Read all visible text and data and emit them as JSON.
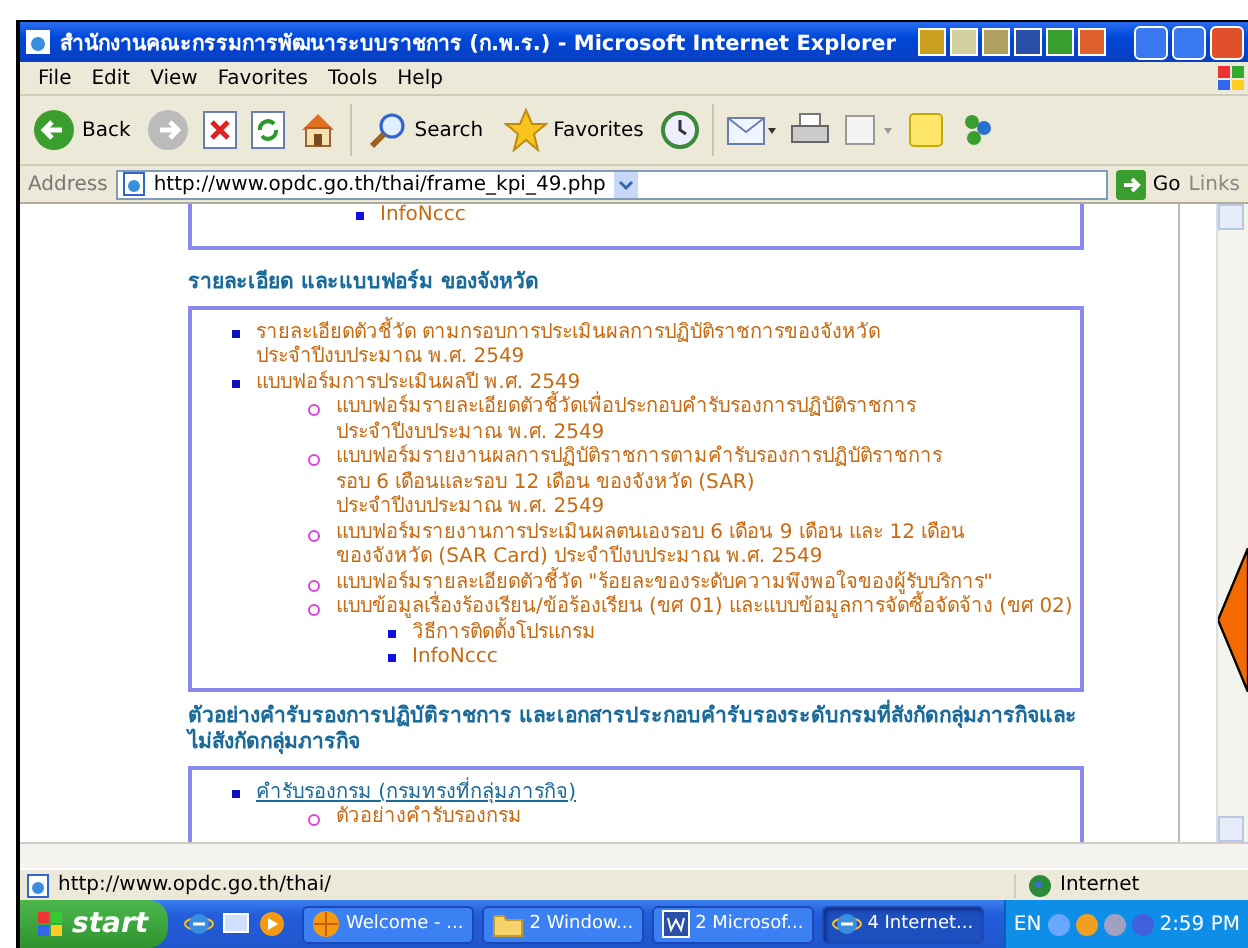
{
  "window": {
    "title": "สำนักงานคณะกรรมการพัฒนาระบบราชการ (ก.พ.ร.) - Microsoft Internet Explorer"
  },
  "menu": [
    "File",
    "Edit",
    "View",
    "Favorites",
    "Tools",
    "Help"
  ],
  "toolbar": [
    {
      "kind": "back",
      "label": "Back"
    },
    {
      "kind": "forward"
    },
    {
      "kind": "stop"
    },
    {
      "kind": "refresh"
    },
    {
      "kind": "home"
    },
    {
      "kind": "search",
      "label": "Search"
    },
    {
      "kind": "favorites",
      "label": "Favorites"
    },
    {
      "kind": "history"
    },
    {
      "kind": "mail"
    },
    {
      "kind": "print"
    },
    {
      "kind": "edit"
    },
    {
      "kind": "notes"
    },
    {
      "kind": "messenger"
    }
  ],
  "address": {
    "label": "Address",
    "value": "http://www.opdc.go.th/thai/frame_kpi_49.php",
    "go": "Go",
    "links": "Links"
  },
  "page": {
    "sections": [
      {
        "items": [
          {
            "kind": "square",
            "text": "InfoNccc"
          }
        ]
      },
      {
        "heading": "รายละเอียด และแบบฟอร์ม ของจังหวัด",
        "items": [
          {
            "kind": "disc",
            "text": "รายละเอียดตัวชี้วัด ตามกรอบการประเมินผลการปฏิบัติราชการของจังหวัด\nประจำปีงบประมาณ พ.ศ. 2549"
          },
          {
            "kind": "disc",
            "text": "แบบฟอร์มการประเมินผลปี พ.ศ. 2549",
            "children": [
              {
                "kind": "circle",
                "text": "แบบฟอร์มรายละเอียดตัวชี้วัดเพื่อประกอบคำรับรองการปฏิบัติราชการ\nประจำปีงบประมาณ พ.ศ. 2549"
              },
              {
                "kind": "circle",
                "text": "แบบฟอร์มรายงานผลการปฏิบัติราชการตามคำรับรองการปฏิบัติราชการ\nรอบ 6 เดือนและรอบ 12 เดือน ของจังหวัด (SAR)\nประจำปีงบประมาณ พ.ศ. 2549"
              },
              {
                "kind": "circle",
                "text": "แบบฟอร์มรายงานการประเมินผลตนเองรอบ 6 เดือน 9 เดือน และ 12 เดือน\nของจังหวัด (SAR Card) ประจำปีงบประมาณ พ.ศ. 2549"
              },
              {
                "kind": "circle",
                "text": "แบบฟอร์มรายละเอียดตัวชี้วัด \"ร้อยละของระดับความพึงพอใจของผู้รับบริการ\""
              },
              {
                "kind": "circle",
                "text": "แบบข้อมูลเรื่องร้องเรียน/ข้อร้องเรียน (ขศ 01) และแบบข้อมูลการจัดซื้อจัดจ้าง (ขศ 02)",
                "children": [
                  {
                    "kind": "square",
                    "text": "วิธีการติดตั้งโปรแกรม"
                  },
                  {
                    "kind": "square",
                    "text": "InfoNccc"
                  }
                ]
              }
            ]
          }
        ]
      },
      {
        "heading": "ตัวอย่างคำรับรองการปฏิบัติราชการ และเอกสารประกอบคำรับรองระดับกรมที่สังกัดกลุ่มภารกิจและ\nไม่สังกัดกลุ่มภารกิจ",
        "items": [
          {
            "kind": "link",
            "text": "คำรับรองกรม (กรมทรงที่กลุ่มภารกิจ)",
            "children": [
              {
                "kind": "circle",
                "text": "ตัวอย่างคำรับรองกรม"
              }
            ]
          }
        ]
      }
    ]
  },
  "status": {
    "url": "http://www.opdc.go.th/thai/",
    "zone": "Internet"
  },
  "taskbar": {
    "start": "start",
    "tasks": [
      {
        "kind": "browser",
        "label": "Welcome - ...",
        "selected": false
      },
      {
        "kind": "folder",
        "label": "2 Window...",
        "selected": false
      },
      {
        "kind": "word",
        "label": "2 Microsof...",
        "selected": false
      },
      {
        "kind": "ie",
        "label": "4 Internet...",
        "selected": true
      }
    ],
    "lang": "EN",
    "time": "2:59 PM"
  }
}
